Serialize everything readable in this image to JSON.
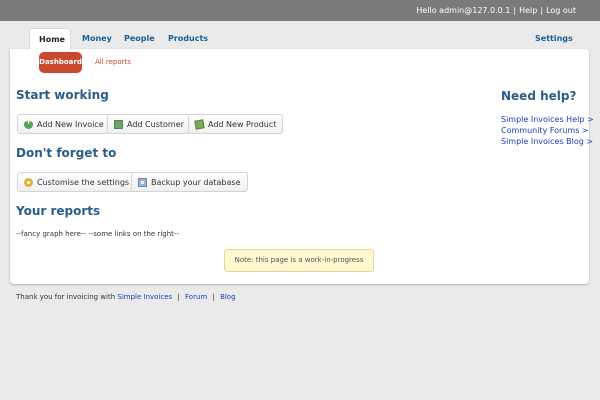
{
  "topbar": {
    "greeting": "Hello admin@127.0.0.1",
    "separator": "|",
    "help": "Help",
    "logout": "Log out"
  },
  "tabs": {
    "home": "Home",
    "money": "Money",
    "people": "People",
    "products": "Products",
    "settings": "Settings"
  },
  "subnav": {
    "dashboard": "Dashboard",
    "all_reports": "All reports"
  },
  "sections": {
    "start_working": "Start working",
    "dont_forget": "Don't forget to",
    "reports": "Your reports",
    "need_help": "Need help?"
  },
  "buttons": {
    "add_invoice": "Add New Invoice",
    "add_customer": "Add Customer",
    "add_product": "Add New Product",
    "customise": "Customise the settings",
    "backup": "Backup your database"
  },
  "reports_placeholder": "--fancy graph here-- --some links on the right--",
  "note": "Note: this page is a work-in-progress",
  "help_links": [
    "Simple Invoices Help >",
    "Community Forums >",
    "Simple Invoices Blog >"
  ],
  "footer": {
    "text": "Thank you for invoicing with",
    "brand": "Simple Invoices",
    "forum": "Forum",
    "blog": "Blog",
    "separator": "|"
  },
  "colors": {
    "topbar": "#7b7b7b",
    "accent": "#c9492e",
    "heading": "#2d5d86",
    "link": "#1a3fb8",
    "note_bg": "#fff7cf"
  }
}
